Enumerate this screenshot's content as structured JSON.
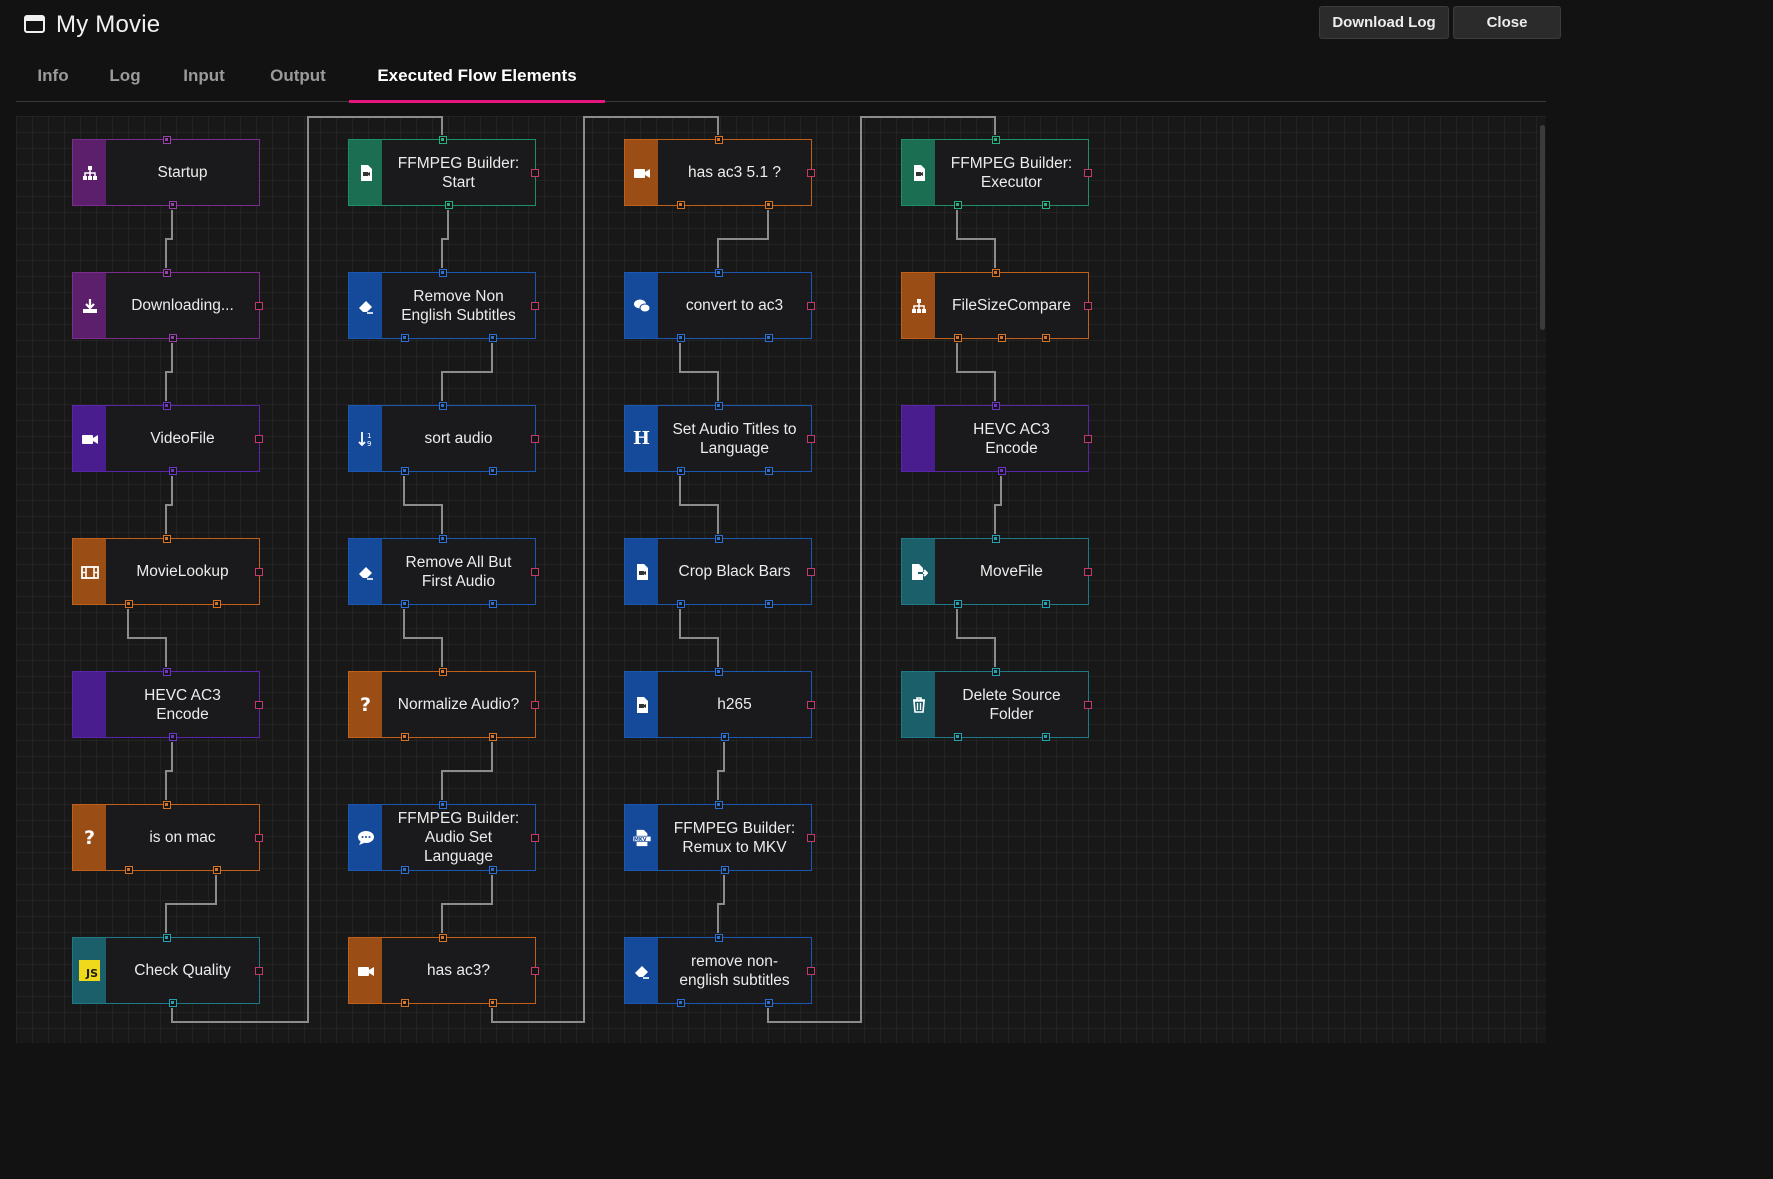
{
  "window": {
    "title": "My Movie",
    "download_log_label": "Download Log",
    "close_label": "Close"
  },
  "tabs": [
    "Info",
    "Log",
    "Input",
    "Output",
    "Executed Flow Elements"
  ],
  "active_tab": "Executed Flow Elements",
  "colors": {
    "accent": "#e5147e",
    "purple": "#7a2d8c",
    "violet": "#5a24a8",
    "orange": "#c0601a",
    "teal": "#1e8e67",
    "blue": "#1c58b0",
    "cyan": "#1f7886"
  },
  "flow": {
    "columns": [
      [
        {
          "label": "Startup",
          "color": "purple",
          "icon": "sitemap-icon",
          "outputs": 1
        },
        {
          "label": "Downloading...",
          "color": "purple",
          "icon": "download-icon",
          "outputs": 1
        },
        {
          "label": "VideoFile",
          "color": "violet",
          "icon": "video-camera-icon",
          "outputs": 1
        },
        {
          "label": "MovieLookup",
          "color": "orange",
          "icon": "film-icon",
          "outputs": 2
        },
        {
          "label": "HEVC AC3\nEncode",
          "color": "violet",
          "icon": "none",
          "outputs": 1
        },
        {
          "label": "is on mac",
          "color": "orange",
          "icon": "question-icon",
          "outputs": 2
        },
        {
          "label": "Check Quality",
          "color": "cyan",
          "icon": "javascript-icon",
          "outputs": 1
        }
      ],
      [
        {
          "label": "FFMPEG Builder:\nStart",
          "color": "teal",
          "icon": "file-video-icon",
          "outputs": 1
        },
        {
          "label": "Remove Non\nEnglish Subtitles",
          "color": "blue",
          "icon": "eraser-icon",
          "outputs": 2
        },
        {
          "label": "sort audio",
          "color": "blue",
          "icon": "sort-icon",
          "outputs": 2
        },
        {
          "label": "Remove All But\nFirst Audio",
          "color": "blue",
          "icon": "eraser-icon",
          "outputs": 2
        },
        {
          "label": "Normalize Audio?",
          "color": "orange",
          "icon": "question-icon",
          "outputs": 2
        },
        {
          "label": "FFMPEG Builder:\nAudio Set\nLanguage",
          "color": "blue",
          "icon": "comment-icon",
          "outputs": 2
        },
        {
          "label": "has ac3?",
          "color": "orange",
          "icon": "video-camera-icon",
          "outputs": 2
        }
      ],
      [
        {
          "label": "has ac3 5.1 ?",
          "color": "orange",
          "icon": "video-camera-icon",
          "outputs": 2
        },
        {
          "label": "convert to ac3",
          "color": "blue",
          "icon": "comments-icon",
          "outputs": 2
        },
        {
          "label": "Set Audio Titles to\nLanguage",
          "color": "blue",
          "icon": "heading-icon",
          "outputs": 2
        },
        {
          "label": "Crop Black Bars",
          "color": "blue",
          "icon": "file-video-icon",
          "outputs": 2
        },
        {
          "label": "h265",
          "color": "blue",
          "icon": "file-video-icon",
          "outputs": 1
        },
        {
          "label": "FFMPEG Builder:\nRemux to MKV",
          "color": "blue",
          "icon": "mkv-icon",
          "outputs": 1
        },
        {
          "label": "remove non-\nenglish subtitles",
          "color": "blue",
          "icon": "eraser-icon",
          "outputs": 2
        }
      ],
      [
        {
          "label": "FFMPEG Builder:\nExecutor",
          "color": "teal",
          "icon": "file-video-icon",
          "outputs": 2
        },
        {
          "label": "FileSizeCompare",
          "color": "orange",
          "icon": "sitemap-icon",
          "outputs": 3
        },
        {
          "label": "HEVC AC3\nEncode",
          "color": "violet",
          "icon": "none",
          "outputs": 1
        },
        {
          "label": "MoveFile",
          "color": "cyan",
          "icon": "file-export-icon",
          "outputs": 2
        },
        {
          "label": "Delete Source\nFolder",
          "color": "cyan",
          "icon": "trash-icon",
          "outputs": 2
        }
      ]
    ]
  }
}
